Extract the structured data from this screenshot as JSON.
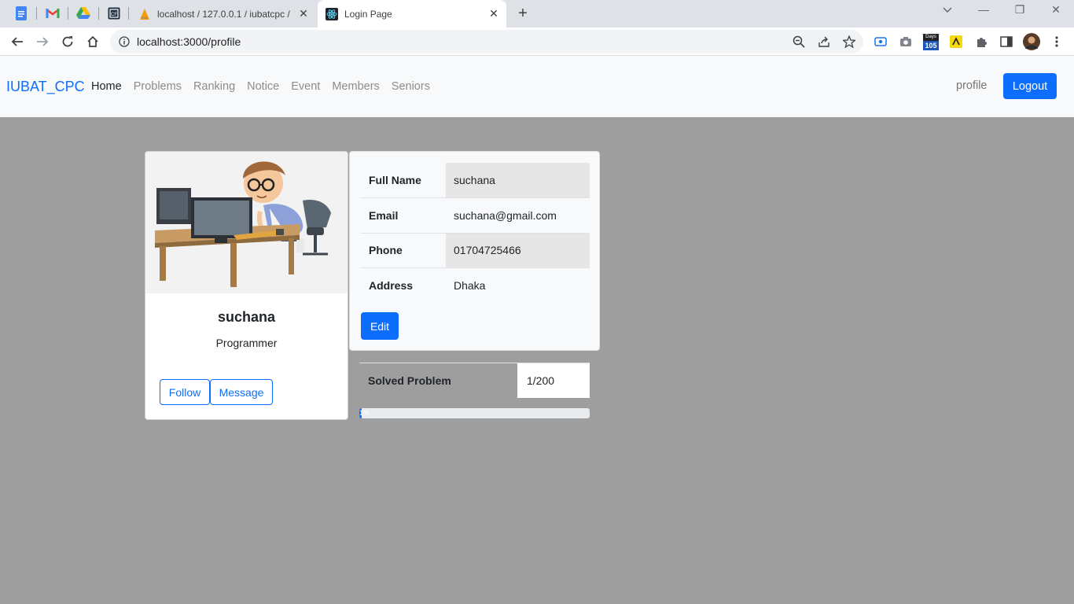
{
  "browser": {
    "tabs": [
      {
        "title": "localhost / 127.0.0.1 / iubatcpc /",
        "close": "✕"
      },
      {
        "title": "Login Page",
        "close": "✕"
      }
    ],
    "new_tab": "+",
    "window_controls": {
      "minimize": "—",
      "maximize": "❐",
      "close": "✕"
    },
    "url": "localhost:3000/profile",
    "extension_badge": "105",
    "extension_label": "Days"
  },
  "navbar": {
    "brand": "IUBAT_CPC",
    "links": [
      "Home",
      "Problems",
      "Ranking",
      "Notice",
      "Event",
      "Members",
      "Seniors"
    ],
    "profile": "profile",
    "logout": "Logout"
  },
  "profile_card": {
    "name": "suchana",
    "role": "Programmer",
    "follow": "Follow",
    "message": "Message"
  },
  "details": [
    {
      "label": "Full Name",
      "value": "suchana"
    },
    {
      "label": "Email",
      "value": "suchana@gmail.com"
    },
    {
      "label": "Phone",
      "value": "01704725466"
    },
    {
      "label": "Address",
      "value": "Dhaka"
    }
  ],
  "edit": "Edit",
  "solved": {
    "label": "Solved Problem",
    "value": "1/200",
    "progress_text": "1%",
    "progress_percent": 1
  },
  "colors": {
    "primary": "#0d6efd",
    "page_bg": "#9e9e9e",
    "navbar_bg": "#f8f9fa"
  }
}
